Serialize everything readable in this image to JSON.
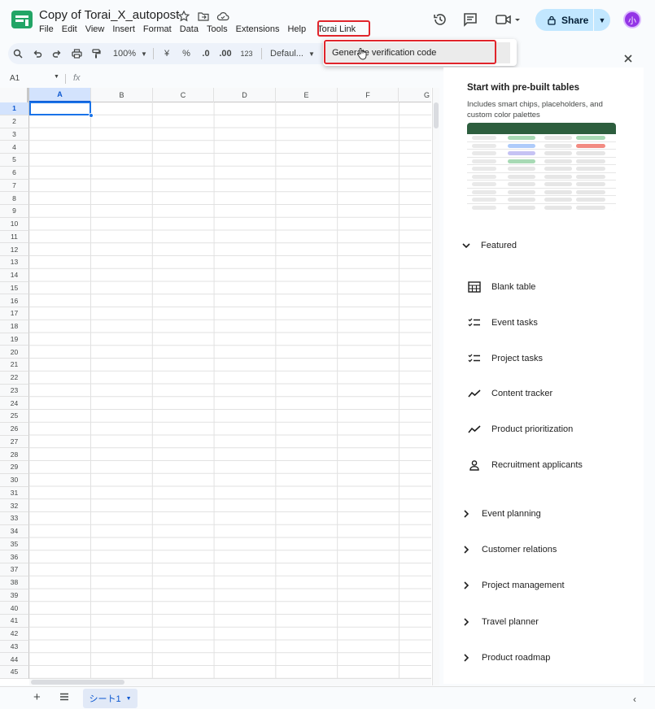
{
  "doc": {
    "title": "Copy of Torai_X_autopost"
  },
  "menu": [
    "File",
    "Edit",
    "View",
    "Insert",
    "Format",
    "Data",
    "Tools",
    "Extensions",
    "Help",
    "Torai Link"
  ],
  "share": {
    "label": "Share"
  },
  "avatar": {
    "letter": "小"
  },
  "toolbar": {
    "zoom": "100%",
    "currency": "¥",
    "percent": "%",
    "dec_less": ".0",
    "dec_more": ".00",
    "number_format": "123",
    "font": "Defaul..."
  },
  "dropdown": {
    "item": "Generate verification code"
  },
  "formula": {
    "cell": "A1",
    "fx": "fx"
  },
  "columns": [
    "A",
    "B",
    "C",
    "D",
    "E",
    "F",
    "G"
  ],
  "rows": [
    "1",
    "2",
    "3",
    "4",
    "5",
    "6",
    "7",
    "8",
    "9",
    "10",
    "11",
    "12",
    "13",
    "14",
    "15",
    "16",
    "17",
    "18",
    "19",
    "20",
    "21",
    "22",
    "23",
    "24",
    "25",
    "26",
    "27",
    "28",
    "29",
    "30",
    "31",
    "32",
    "33",
    "34",
    "35",
    "36",
    "37",
    "38",
    "39",
    "40",
    "41",
    "42",
    "43",
    "44",
    "45"
  ],
  "sheet": {
    "tab": "シート1"
  },
  "panel": {
    "title": "Start with pre-built tables",
    "desc": "Includes smart chips, placeholders, and custom color palettes",
    "featured": "Featured",
    "items": [
      "Blank table",
      "Event tasks",
      "Project tasks",
      "Content tracker",
      "Product prioritization",
      "Recruitment applicants"
    ],
    "categories": [
      "Event planning",
      "Customer relations",
      "Project management",
      "Travel planner",
      "Product roadmap"
    ]
  },
  "colors": {
    "accent": "#1a73e8",
    "share_bg": "#c2e7ff",
    "highlight_red": "#e0242b",
    "avatar": "#9334e6",
    "template_header": "#2d5e3e"
  }
}
